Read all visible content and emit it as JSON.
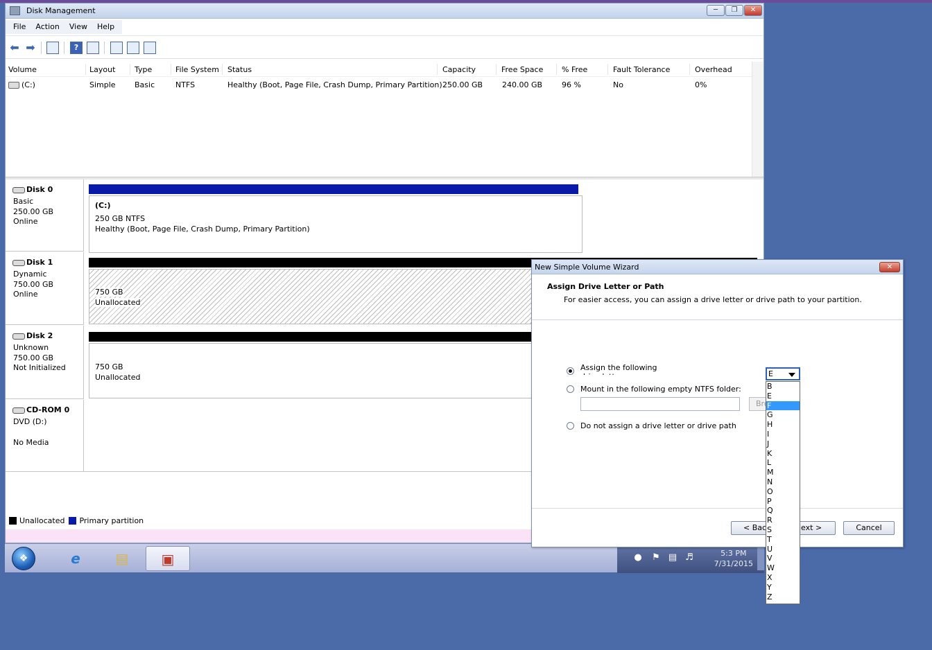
{
  "window": {
    "title": "Disk Management"
  },
  "menu": [
    "File",
    "Action",
    "View",
    "Help"
  ],
  "columns": [
    "Volume",
    "Layout",
    "Type",
    "File System",
    "Status",
    "Capacity",
    "Free Space",
    "% Free",
    "Fault Tolerance",
    "Overhead"
  ],
  "volumes": [
    {
      "volume": "(C:)",
      "layout": "Simple",
      "type": "Basic",
      "fs": "NTFS",
      "status": "Healthy (Boot, Page File, Crash Dump, Primary Partition)",
      "capacity": "250.00 GB",
      "free": "240.00 GB",
      "pct": "96 %",
      "fault": "No",
      "overhead": "0%"
    }
  ],
  "disks": [
    {
      "name": "Disk 0",
      "type": "Basic",
      "size": "250.00 GB",
      "state": "Online",
      "part_title": "(C:)",
      "part_line1": "250 GB NTFS",
      "part_line2": "Healthy (Boot, Page File, Crash Dump, Primary Partition)"
    },
    {
      "name": "Disk 1",
      "type": "Dynamic",
      "size": "750.00 GB",
      "state": "Online",
      "part_line1": "750 GB",
      "part_line2": "Unallocated"
    },
    {
      "name": "Disk 2",
      "type": "Unknown",
      "size": "750.00 GB",
      "state": "Not Initialized",
      "part_line1": "750 GB",
      "part_line2": "Unallocated"
    },
    {
      "name": "CD-ROM 0",
      "type": "DVD (D:)",
      "state": "No Media"
    }
  ],
  "legend": {
    "unallocated": "Unallocated",
    "primary": "Primary partition",
    "unallocated_color": "#000000",
    "primary_color": "#0a1aa8"
  },
  "taskbar": {
    "time": "5:3 PM",
    "date": "7/31/2015"
  },
  "wizard": {
    "title": "New Simple Volume Wizard",
    "heading": "Assign Drive Letter or Path",
    "subheading": "For easier access, you can assign a drive letter or drive path to your partition.",
    "opt_assign": "Assign the following drive letter:",
    "opt_mount": "Mount in the following empty NTFS folder:",
    "opt_none": "Do not assign a drive letter or drive path",
    "browse_label": "Browse...",
    "back_label": "< Back",
    "next_label": "Next >",
    "cancel_label": "Cancel",
    "selected_letter": "E",
    "highlighted_letter": "F",
    "letters": [
      "B",
      "E",
      "F",
      "G",
      "H",
      "I",
      "J",
      "K",
      "L",
      "M",
      "N",
      "O",
      "P",
      "Q",
      "R",
      "S",
      "T",
      "U",
      "V",
      "W",
      "X",
      "Y",
      "Z"
    ]
  },
  "colors": {
    "primary_partition_bar": "#0a1aa8",
    "unallocated_bar": "#000000",
    "desktop": "#4a6aa8",
    "selection": "#3399ff"
  }
}
